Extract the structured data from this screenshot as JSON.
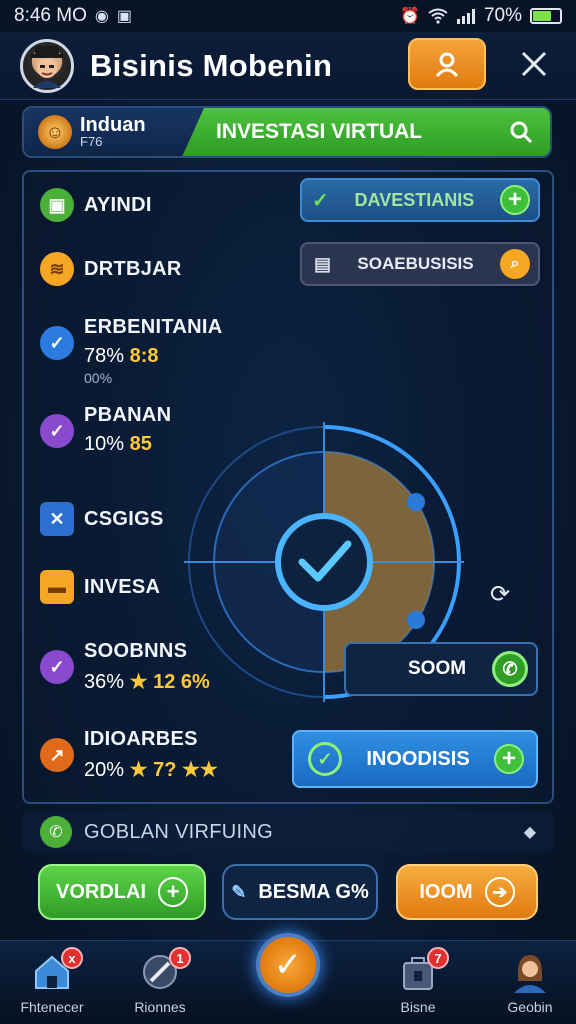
{
  "status_bar": {
    "time": "8:46 MO",
    "battery": "70%",
    "battery_level": 0.7
  },
  "header": {
    "title": "Bisinis Mobenin",
    "profile_icon": "user-icon",
    "close_icon": "close-icon"
  },
  "banner": {
    "name": "Induan",
    "sub": "F76",
    "title": "INVESTASI VIRTUAL",
    "icon": "search-icon"
  },
  "items": [
    {
      "title": "AYINDI",
      "icon": "cube-icon",
      "color": "#4caf3a"
    },
    {
      "title": "DRTBJAR",
      "icon": "coin-stack-icon",
      "color": "#f5a623"
    },
    {
      "title": "ERBENITANIA",
      "value": "78%",
      "accent": "8:8",
      "sub": "00%",
      "icon": "check-circle-icon",
      "color": "#2c7be0"
    },
    {
      "title": "PBANAN",
      "value": "10%",
      "accent": "85",
      "icon": "check-circle-icon",
      "color": "#8a4ad0"
    },
    {
      "title": "CSGIGS",
      "icon": "tools-icon",
      "color": "#2c6fd0"
    },
    {
      "title": "INVESA",
      "icon": "folder-icon",
      "color": "#f5a623"
    },
    {
      "title": "SOOBNNS",
      "value": "36%",
      "accent": "12 6%",
      "icon": "check-circle-icon",
      "color": "#8a4ad0"
    },
    {
      "title": "IDIOARBES",
      "value": "20%",
      "accent": "7? ★★",
      "icon": "chart-icon",
      "color": "#e06a1a"
    }
  ],
  "side_buttons": {
    "davestianis": "DAVESTIANIS",
    "soaebisis": "SOAEBUSISIS",
    "soom": "SOOM",
    "inoodisis": "INOODISIS"
  },
  "footer_row": {
    "label": "GOBLAN VIRFUING"
  },
  "actions": {
    "left": "VORDLAI",
    "middle": "BESMA G%",
    "right": "IOOM"
  },
  "nav": {
    "home_label": "Fhtenecer",
    "home_badge": "x",
    "rionnes_label": "Rionnes",
    "rionnes_badge": "1",
    "bisne_label": "Bisne",
    "bisne_badge": "7",
    "profile_label": "Geobin"
  }
}
